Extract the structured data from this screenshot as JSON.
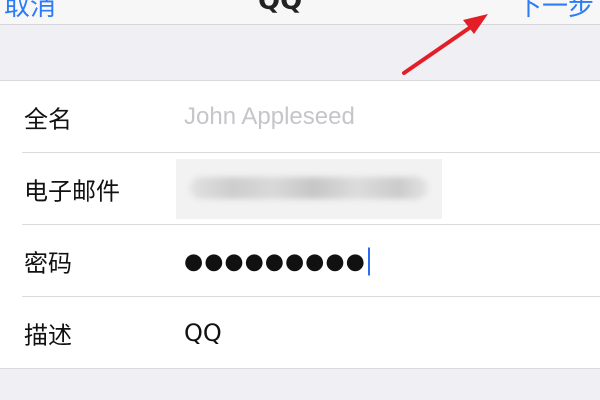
{
  "navbar": {
    "left_label": "取消",
    "title": "QQ",
    "right_label": "下一步"
  },
  "form": {
    "full_name": {
      "label": "全名",
      "placeholder": "John Appleseed"
    },
    "email": {
      "label": "电子邮件",
      "value": ""
    },
    "password": {
      "label": "密码",
      "value": "●●●●●●●●●"
    },
    "description": {
      "label": "描述",
      "value": "QQ"
    }
  },
  "colors": {
    "accent": "#2c7cf6",
    "annotation_arrow": "#e41e26",
    "background": "#efeff4"
  }
}
